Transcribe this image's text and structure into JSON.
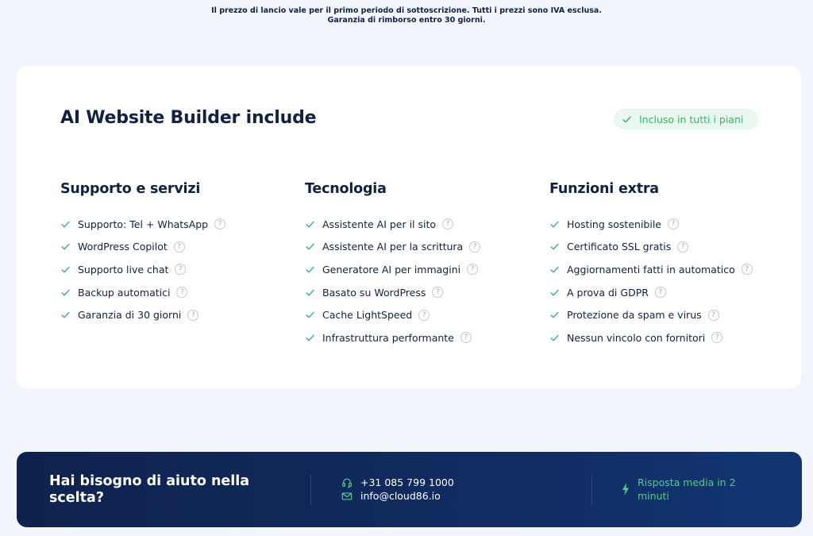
{
  "notice": {
    "line1": "Il prezzo di lancio vale per il primo periodo di sottoscrizione. Tutti i prezzi sono IVA esclusa.",
    "line2": "Garanzia di rimborso entro 30 giorni."
  },
  "card": {
    "title": "AI Website Builder include",
    "badge": "Incluso in tutti i piani"
  },
  "columns": [
    {
      "title": "Supporto e servizi",
      "items": [
        "Supporto: Tel + WhatsApp",
        "WordPress Copilot",
        "Supporto live chat",
        "Backup automatici",
        "Garanzia di 30 giorni"
      ]
    },
    {
      "title": "Tecnologia",
      "items": [
        "Assistente AI per il sito",
        "Assistente AI per la scrittura",
        "Generatore AI per immagini",
        "Basato su WordPress",
        "Cache LightSpeed",
        "Infrastruttura performante"
      ]
    },
    {
      "title": "Funzioni extra",
      "items": [
        "Hosting sostenibile",
        "Certificato SSL gratis",
        "Aggiornamenti fatti in automatico",
        "A prova di GDPR",
        "Protezione da spam e virus",
        "Nessun vincolo con fornitori"
      ]
    }
  ],
  "help_glyph": "?",
  "help_banner": {
    "title": "Hai bisogno di aiuto nella scelta?",
    "phone": "+31 085 799 1000",
    "email": "info@cloud86.io",
    "response": "Risposta media in 2 minuti"
  },
  "colors": {
    "accent_green": "#3fae6d",
    "navy": "#12213f",
    "banner_start": "#0f224d",
    "banner_end": "#133673"
  }
}
